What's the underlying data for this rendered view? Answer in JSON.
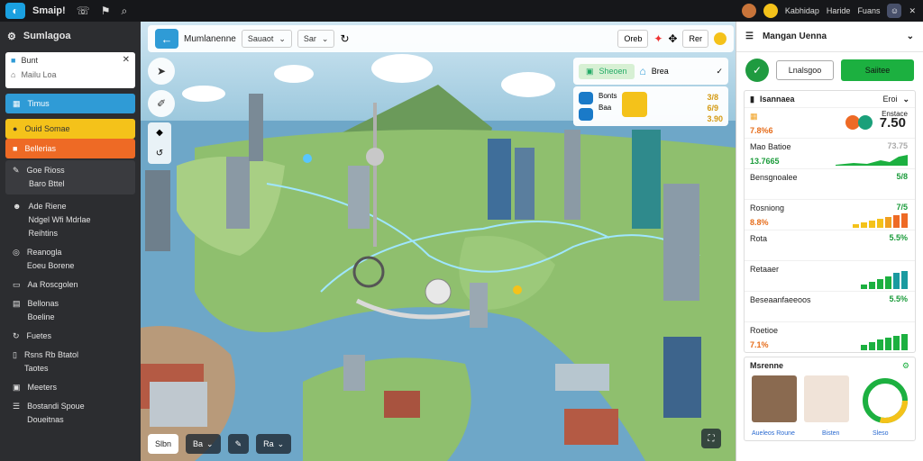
{
  "topbar": {
    "app_title": "Smaip!",
    "icons": [
      "logo-icon",
      "phone-icon",
      "flag-icon",
      "search-icon"
    ],
    "user_name": "Kabhidap",
    "menu1": "Haride",
    "menu2": "Fuans",
    "close": "✕"
  },
  "sidebar": {
    "title": "Sumlagoa",
    "search_tag": "Bunt",
    "search_placeholder": "Mailu Loa",
    "items": [
      {
        "label": "Timus",
        "style": "blue"
      },
      {
        "label": "Ouid Somae",
        "style": "yellow"
      },
      {
        "label": "Bellerias",
        "style": "orange"
      }
    ],
    "group": {
      "line1": "Goe Rioss",
      "line2": "Baro Bttel"
    },
    "plain": [
      {
        "lines": [
          "Ade Riene",
          "Ndgel Wfi Mdrlae",
          "Reihtins"
        ]
      },
      {
        "lines": [
          "Reanogla",
          "Eoeu Borene"
        ]
      },
      {
        "lines": [
          "Aa Roscgolen"
        ]
      },
      {
        "lines": [
          "Bellonas",
          "Boeline"
        ]
      },
      {
        "lines": [
          "Fuetes"
        ]
      },
      {
        "lines": [
          "Rsns Rb Btatol",
          "Taotes"
        ]
      },
      {
        "lines": [
          "Meeters"
        ]
      },
      {
        "lines": [
          "Bostandi Spoue",
          "Doueitnas"
        ]
      }
    ]
  },
  "map_toolbar": {
    "title": "Mumlanenne",
    "select1": "Sauaot",
    "select2": "Sar",
    "btn1": "Oreb",
    "btn2": "Rer"
  },
  "map_legend": {
    "green_label": "Sheoen",
    "label2": "Brea",
    "x": "✕"
  },
  "map_info": {
    "l1": "Bonts",
    "l2": "Baa",
    "n1": "3/8",
    "n2": "6/9",
    "n3": "3.90"
  },
  "map_bottom": {
    "b1": "Slbn",
    "b2": "Ba",
    "b3": "Ra"
  },
  "rpanel": {
    "title": "Mangan Uenna",
    "btn_outline": "Lnalsgoo",
    "btn_green": "Saiitee",
    "section_title": "Isannaea",
    "section_right": "Eroi",
    "rows": [
      {
        "label": "",
        "value": "7.8%6",
        "right_label": "Enstace",
        "big": "7.50",
        "value_color": "#e66c1a"
      },
      {
        "label": "Mao Batioe",
        "value": "13.7665",
        "rv": "73.75",
        "value_color": "#1a9b3a"
      },
      {
        "label": "Bensgnoalee",
        "value": "",
        "rv": "5/8",
        "value_color": "#1a9b3a"
      },
      {
        "label": "Rosniong",
        "value": "8.8%",
        "rv": "7/5",
        "value_color": "#e66c1a"
      },
      {
        "label": "Rota",
        "value": "",
        "rv": "5.5%",
        "value_color": "#1a9b3a"
      },
      {
        "label": "Retaaer",
        "value": "",
        "rv": "",
        "value_color": "#1a9b3a"
      },
      {
        "label": "Beseaanfaeeoos",
        "value": "",
        "rv": "5.5%",
        "value_color": "#1a9b3a"
      },
      {
        "label": "Roetioe",
        "value": "7.1%",
        "rv": "",
        "value_color": "#e66c1a"
      }
    ],
    "bottom_title": "Msrenne",
    "cap1": "Aueleos Roune",
    "cap2": "Bisten",
    "cap3": "Sleso"
  },
  "colors": {
    "accent": "#2f9bd6",
    "green": "#1cb040",
    "orange": "#ee6a25",
    "yellow": "#f4c21a"
  }
}
